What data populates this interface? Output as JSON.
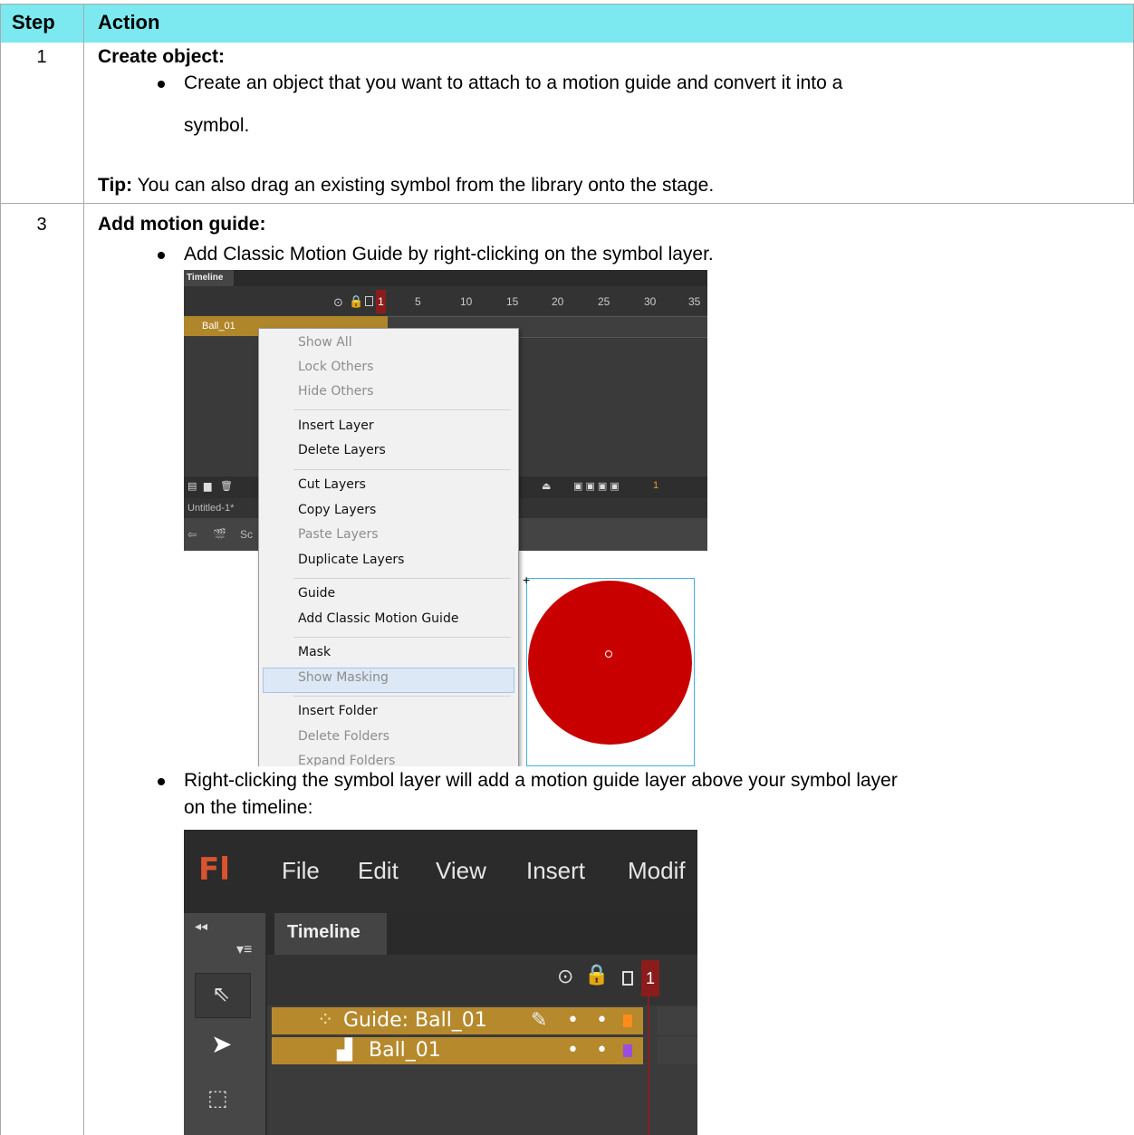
{
  "table": {
    "header": {
      "step": "Step",
      "action": "Action"
    },
    "rows": [
      {
        "step": "1",
        "title": "Create object:",
        "bullet1_line1": "Create an object that you want to attach to a motion guide and convert it into a",
        "bullet1_line2": "symbol.",
        "tip_label": "Tip:",
        "tip_text": " You can also drag an existing symbol from the library onto the stage."
      },
      {
        "step": "3",
        "title": "Add motion guide:",
        "bullet1": "Add Classic Motion Guide by right-clicking on the symbol layer.",
        "bullet2_line1": "Right-clicking the symbol layer will add a motion guide layer above your symbol layer",
        "bullet2_line2": "on the timeline:"
      }
    ]
  },
  "screenshot1": {
    "tab": "Timeline",
    "ruler_numbers": [
      "5",
      "10",
      "15",
      "20",
      "25",
      "30",
      "35"
    ],
    "playhead": "1",
    "layer_name": "Ball_01",
    "doc_tab": "Untitled-1*",
    "scene": "Sc",
    "bottom_value": "1",
    "context_menu": [
      {
        "label": "Show All",
        "disabled": true
      },
      {
        "label": "Lock Others",
        "disabled": true
      },
      {
        "label": "Hide Others",
        "disabled": true
      },
      {
        "label": "Insert Layer",
        "disabled": false
      },
      {
        "label": "Delete Layers",
        "disabled": false
      },
      {
        "label": "Cut Layers",
        "disabled": false
      },
      {
        "label": "Copy Layers",
        "disabled": false
      },
      {
        "label": "Paste Layers",
        "disabled": true
      },
      {
        "label": "Duplicate Layers",
        "disabled": false
      },
      {
        "label": "Guide",
        "disabled": false
      },
      {
        "label": "Add Classic Motion Guide",
        "disabled": false,
        "highlighted": true
      },
      {
        "label": "Mask",
        "disabled": false
      },
      {
        "label": "Show Masking",
        "disabled": true
      },
      {
        "label": "Insert Folder",
        "disabled": false
      },
      {
        "label": "Delete Folders",
        "disabled": true
      },
      {
        "label": "Expand Folders",
        "disabled": true
      }
    ],
    "ball_color": "#c80000"
  },
  "screenshot2": {
    "logo": "Fl",
    "menu": [
      "File",
      "Edit",
      "View",
      "Insert",
      "Modif"
    ],
    "tab": "Timeline",
    "playhead": "1",
    "guide_layer": "Guide: Ball_01",
    "layer": "Ball_01"
  }
}
